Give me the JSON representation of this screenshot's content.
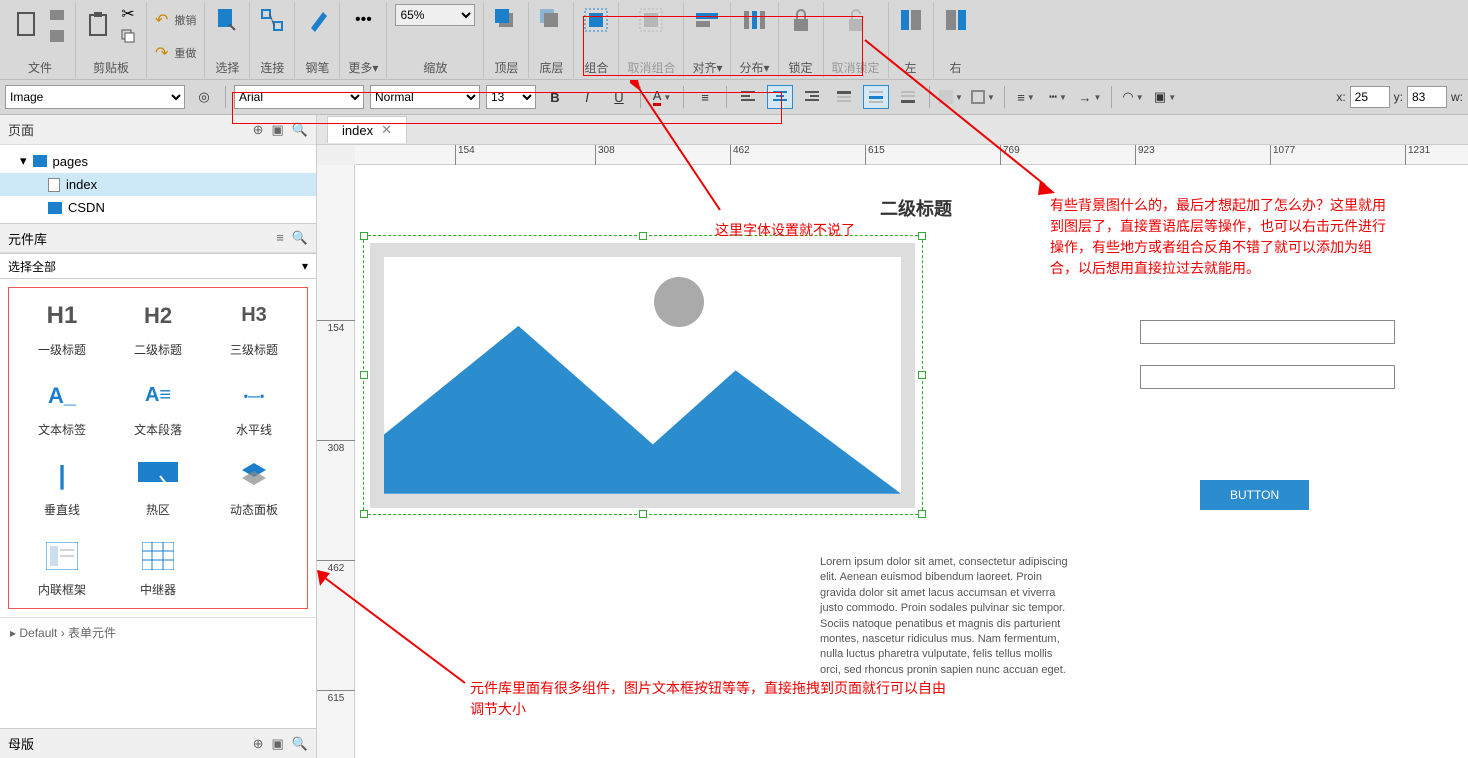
{
  "toolbar": {
    "file": "文件",
    "clipboard": "剪贴板",
    "undo": "撤销",
    "redo": "重做",
    "select": "选择",
    "connect": "连接",
    "pen": "钢笔",
    "more": "更多▾",
    "zoom": "缩放",
    "zoom_value": "65%",
    "front": "顶层",
    "back": "底层",
    "group": "组合",
    "ungroup": "取消组合",
    "align": "对齐▾",
    "distribute": "分布▾",
    "lock": "锁定",
    "unlock": "取消锁定",
    "left": "左",
    "right": "右"
  },
  "format_bar": {
    "element_type": "Image",
    "font": "Arial",
    "weight": "Normal",
    "size": "13"
  },
  "coords": {
    "x_label": "x:",
    "x": "25",
    "y_label": "y:",
    "y": "83",
    "w_label": "w:"
  },
  "left": {
    "pages_header": "页面",
    "tree_root": "pages",
    "tree_index": "index",
    "tree_csdn": "CSDN",
    "library_header": "元件库",
    "select_all": "选择全部",
    "widgets": [
      {
        "name": "一级标题",
        "preview": "H1"
      },
      {
        "name": "二级标题",
        "preview": "H2"
      },
      {
        "name": "三级标题",
        "preview": "H3"
      },
      {
        "name": "文本标签",
        "preview": "A_"
      },
      {
        "name": "文本段落",
        "preview": "A≡"
      },
      {
        "name": "水平线",
        "preview": "•—•"
      },
      {
        "name": "垂直线",
        "preview": "|"
      },
      {
        "name": "热区",
        "preview": "▭"
      },
      {
        "name": "动态面板",
        "preview": "◈"
      },
      {
        "name": "内联框架",
        "preview": "▦"
      },
      {
        "name": "中继器",
        "preview": "▦"
      }
    ],
    "default_lib": "Default › 表单元件",
    "master_header": "母版"
  },
  "tab": {
    "name": "index"
  },
  "ruler_h": [
    "154",
    "308",
    "462",
    "615",
    "769",
    "923",
    "1077",
    "1231"
  ],
  "ruler_v": [
    "154",
    "308",
    "462",
    "615"
  ],
  "canvas": {
    "heading": "二级标题",
    "button": "BUTTON",
    "lorem": "Lorem ipsum dolor sit amet, consectetur adipiscing elit. Aenean euismod bibendum laoreet. Proin gravida dolor sit amet lacus accumsan et viverra justo commodo. Proin sodales pulvinar sic tempor. Sociis natoque penatibus et magnis dis parturient montes, nascetur ridiculus mus. Nam fermentum, nulla luctus pharetra vulputate, felis tellus mollis orci, sed rhoncus pronin sapien nunc accuan eget."
  },
  "annotations": {
    "a1": "这里字体设置就不说了",
    "a2": "有些背景图什么的，最后才想起加了怎么办？这里就用到图层了，直接置语底层等操作，也可以右击元件进行操作，有些地方或者组合反角不错了就可以添加为组合，以后想用直接拉过去就能用。",
    "a3": "元件库里面有很多组件，图片文本框按钮等等，直接拖拽到页面就行可以自由调节大小"
  }
}
